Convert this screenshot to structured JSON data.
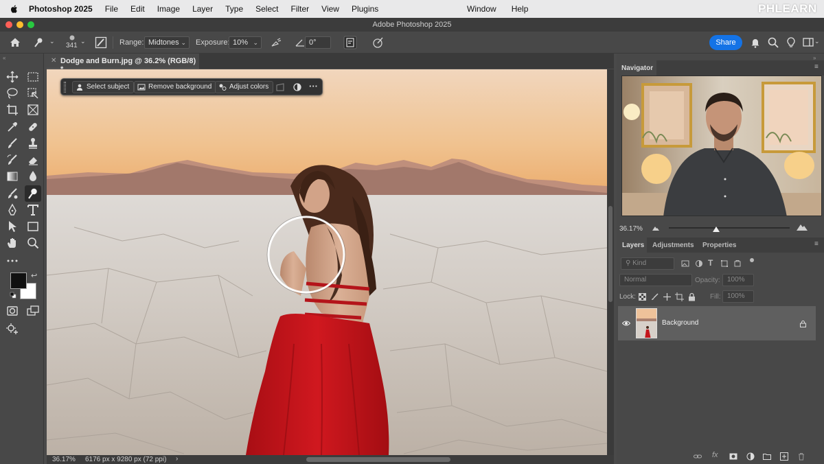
{
  "menubar": {
    "app_name": "Photoshop 2025",
    "items": [
      "File",
      "Edit",
      "Image",
      "Layer",
      "Type",
      "Select",
      "Filter",
      "View",
      "Plugins"
    ],
    "right_items": [
      "Window",
      "Help"
    ],
    "watermark": "PHLEARN"
  },
  "window": {
    "title": "Adobe Photoshop 2025"
  },
  "options_bar": {
    "brush_size": "341",
    "range_label": "Range:",
    "range_value": "Midtones",
    "exposure_label": "Exposure:",
    "exposure_value": "10%",
    "angle_value": "0°",
    "share_label": "Share"
  },
  "document": {
    "tab_title": "Dodge and Burn.jpg @ 36.2% (RGB/8) *",
    "status_zoom": "36.17%",
    "status_info": "6176 px x 9280 px (72 ppi)"
  },
  "taskbar": {
    "select_subject": "Select subject",
    "remove_background": "Remove background",
    "adjust_colors": "Adjust colors"
  },
  "navigator": {
    "tab_label": "Navigator",
    "zoom": "36.17%",
    "zoom_slider_fraction": 0.39
  },
  "layers_panel": {
    "tabs": [
      "Layers",
      "Adjustments",
      "Properties"
    ],
    "kind_placeholder": "Kind",
    "blend_mode": "Normal",
    "opacity_label": "Opacity:",
    "opacity_value": "100%",
    "lock_label": "Lock:",
    "fill_label": "Fill:",
    "fill_value": "100%",
    "layers": [
      {
        "name": "Background",
        "visible": true,
        "locked": true
      }
    ]
  },
  "colors": {
    "accent": "#1473e6",
    "foreground_swatch": "#111111",
    "background_swatch": "#ffffff",
    "dress": "#c4161c"
  }
}
